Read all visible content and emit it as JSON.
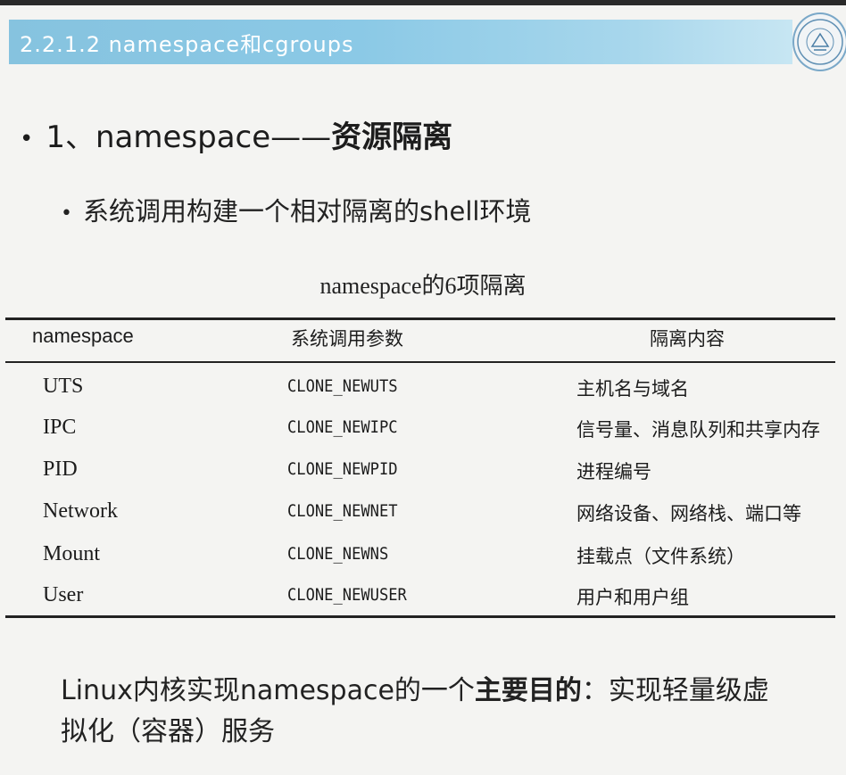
{
  "header": {
    "title": "2.2.1.2  namespace和cgroups"
  },
  "heading1": {
    "bullet": "•",
    "prefix": "1、namespace——",
    "emphasis": "资源隔离"
  },
  "heading2": {
    "bullet": "•",
    "text": "系统调用构建一个相对隔离的shell环境"
  },
  "table": {
    "caption": "namespace的6项隔离",
    "columns": [
      "namespace",
      "系统调用参数",
      "隔离内容"
    ],
    "rows": [
      [
        "UTS",
        "CLONE_NEWUTS",
        "主机名与域名"
      ],
      [
        "IPC",
        "CLONE_NEWIPC",
        "信号量、消息队列和共享内存"
      ],
      [
        "PID",
        "CLONE_NEWPID",
        "进程编号"
      ],
      [
        "Network",
        "CLONE_NEWNET",
        "网络设备、网络栈、端口等"
      ],
      [
        "Mount",
        "CLONE_NEWNS",
        "挂载点（文件系统）"
      ],
      [
        "User",
        "CLONE_NEWUSER",
        "用户和用户组"
      ]
    ]
  },
  "summary": {
    "prefix": "Linux内核实现namespace的一个",
    "emphasis": "主要目的",
    "suffix": "：实现轻量级虚拟化（容器）服务"
  },
  "icons": {
    "logo": "university-seal-icon"
  },
  "colors": {
    "header_bar": "#8bc9e6",
    "header_text": "#ffffff",
    "background": "#f4f4f2"
  }
}
